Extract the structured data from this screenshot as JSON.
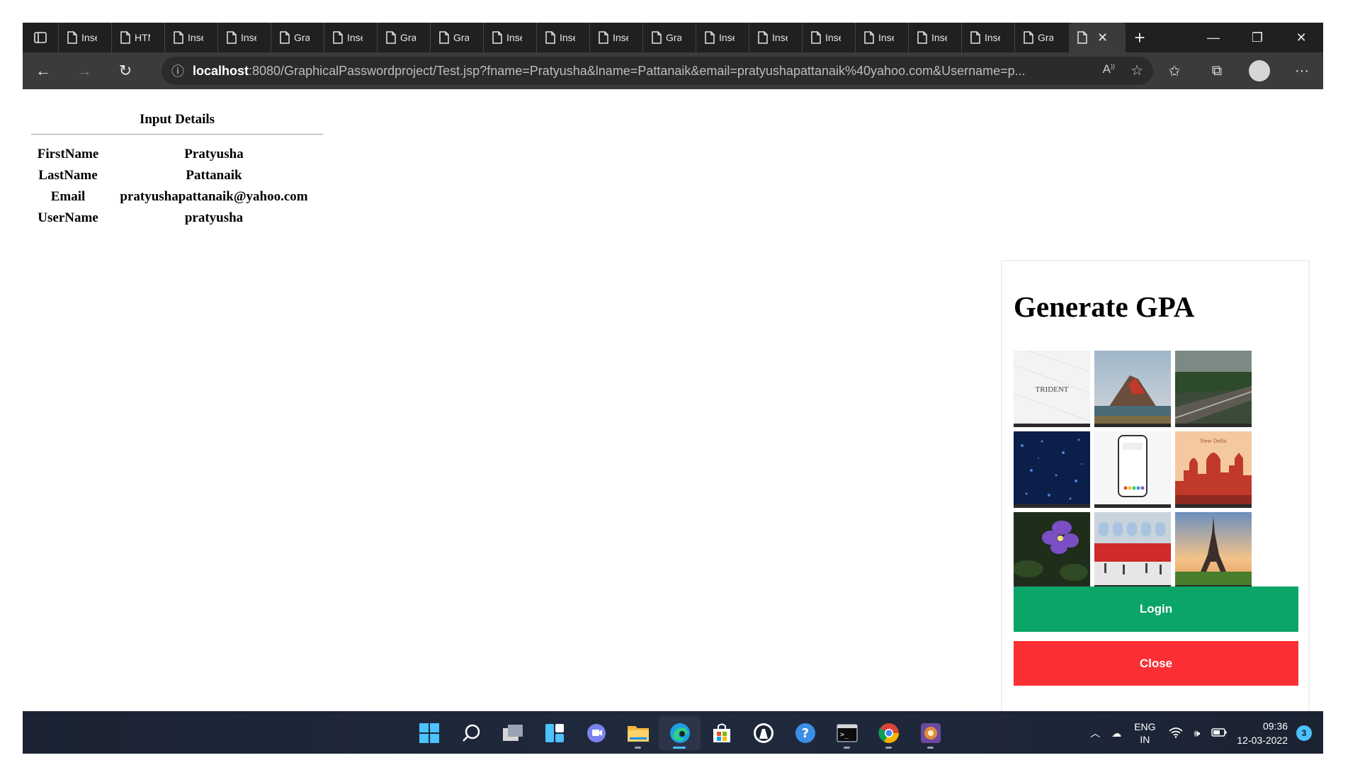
{
  "browser": {
    "tabs": [
      {
        "label": "Insert",
        "icon": "document-icon"
      },
      {
        "label": "HTML",
        "icon": "document-icon"
      },
      {
        "label": "Insert",
        "icon": "document-icon"
      },
      {
        "label": "Insert",
        "icon": "document-icon"
      },
      {
        "label": "Graphical",
        "icon": "document-icon"
      },
      {
        "label": "Insert",
        "icon": "document-icon"
      },
      {
        "label": "Graphical",
        "icon": "document-icon"
      },
      {
        "label": "Graphical",
        "icon": "document-icon"
      },
      {
        "label": "Insert",
        "icon": "document-icon"
      },
      {
        "label": "Insert",
        "icon": "document-icon"
      },
      {
        "label": "Insert",
        "icon": "document-icon"
      },
      {
        "label": "Graphical",
        "icon": "document-icon"
      },
      {
        "label": "Insert",
        "icon": "document-icon"
      },
      {
        "label": "Insert",
        "icon": "document-icon"
      },
      {
        "label": "Insert",
        "icon": "document-icon"
      },
      {
        "label": "Insert",
        "icon": "document-icon"
      },
      {
        "label": "Insert",
        "icon": "document-icon"
      },
      {
        "label": "Insert",
        "icon": "document-icon"
      },
      {
        "label": "Graphical",
        "icon": "document-icon"
      }
    ],
    "url_host": "localhost",
    "url_rest": ":8080/GraphicalPasswordproject/Test.jsp?fname=Pratyusha&lname=Pattanaik&email=pratyushapattanaik%40yahoo.com&Username=p..."
  },
  "details": {
    "title": "Input Details",
    "rows": [
      {
        "key": "FirstName",
        "value": "Pratyusha"
      },
      {
        "key": "LastName",
        "value": "Pattanaik"
      },
      {
        "key": "Email",
        "value": "pratyushapattanaik@yahoo.com"
      },
      {
        "key": "UserName",
        "value": "pratyusha"
      }
    ]
  },
  "gpa": {
    "title": "Generate GPA",
    "tiles": [
      {
        "name": "trident",
        "caption": "TRIDENT"
      },
      {
        "name": "volcano-landscape"
      },
      {
        "name": "railway-forest"
      },
      {
        "name": "blue-stars"
      },
      {
        "name": "phone-screen"
      },
      {
        "name": "city-sunset",
        "caption": "New Delhi"
      },
      {
        "name": "purple-flower"
      },
      {
        "name": "red-train"
      },
      {
        "name": "eiffel-tower"
      }
    ],
    "login_label": "Login",
    "close_label": "Close"
  },
  "taskbar": {
    "apps": [
      "start-icon",
      "search-icon",
      "task-view-icon",
      "widgets-icon",
      "chat-icon",
      "file-explorer-icon",
      "edge-icon",
      "store-icon",
      "app-icon",
      "help-icon",
      "terminal-icon",
      "chrome-icon",
      "app2-icon"
    ],
    "lang_top": "ENG",
    "lang_bottom": "IN",
    "time": "09:36",
    "date": "12-03-2022",
    "notifications": "3"
  },
  "colors": {
    "login": "#0aa567",
    "close": "#fb2f33",
    "taskbar": "#1b2333",
    "accent": "#4cc2ff"
  }
}
